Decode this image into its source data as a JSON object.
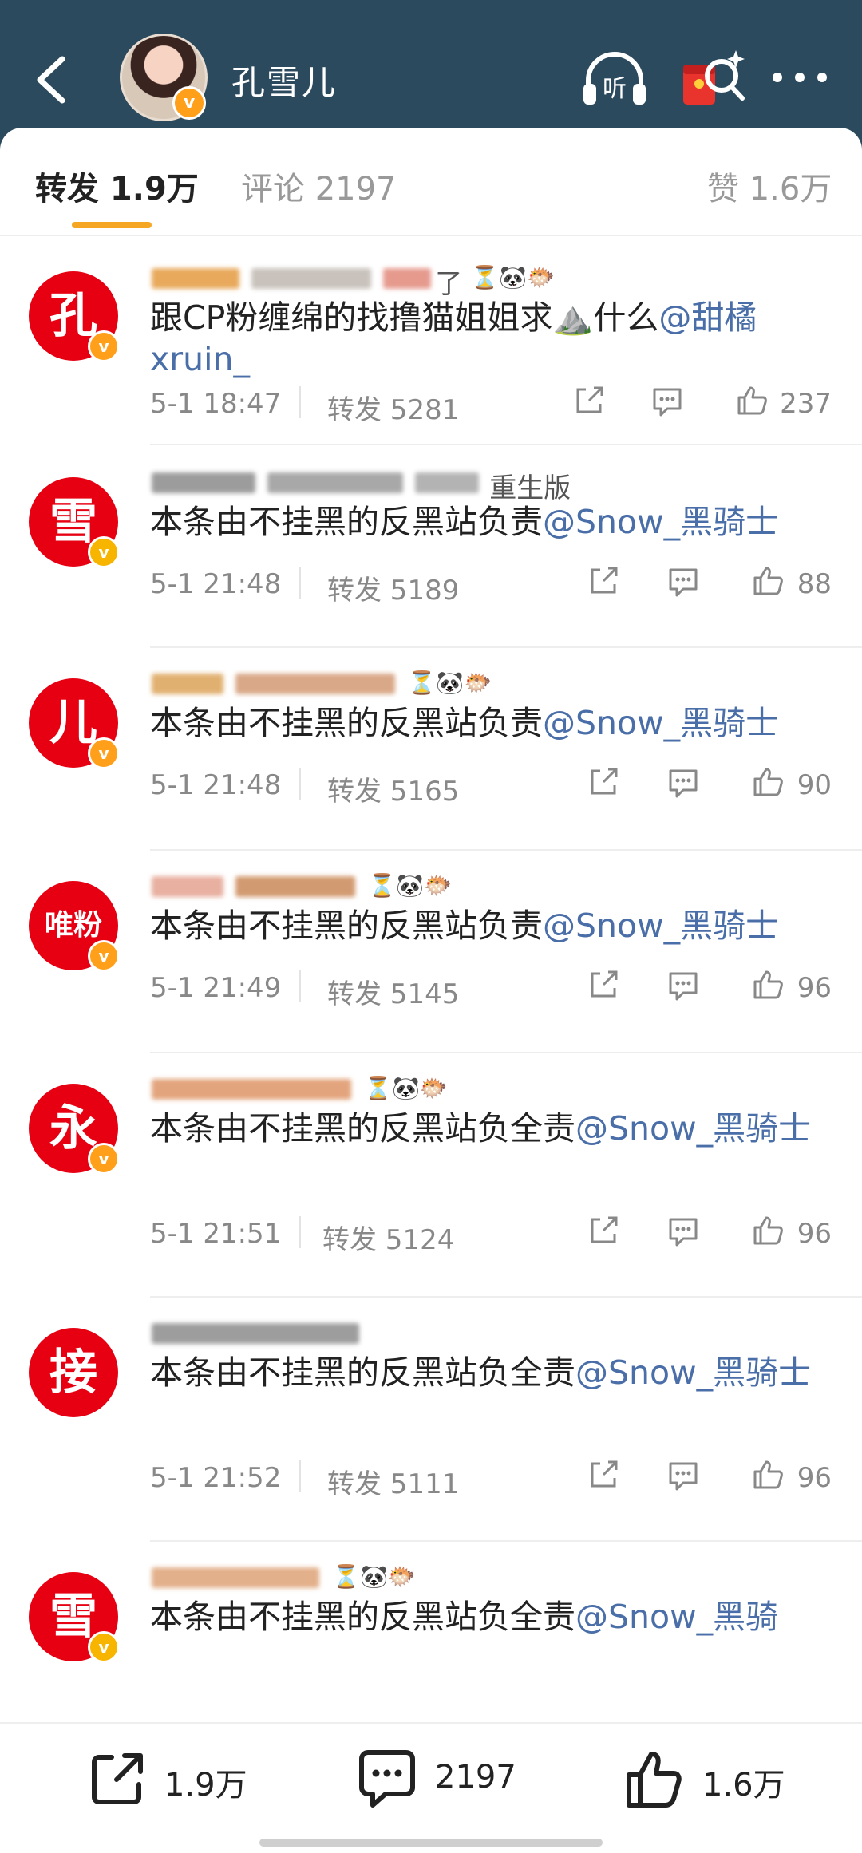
{
  "header": {
    "title": "孔雪儿",
    "verified_mark": "v",
    "listen_label": "听",
    "bg_color": "#2b4a5e"
  },
  "tabs": {
    "repost_label": "转发 1.9万",
    "comment_label": "评论 2197",
    "like_label": "赞 1.6万",
    "accent_color": "#f5a623"
  },
  "reposts": [
    {
      "avatar_text": "孔",
      "nickname_visible": "了",
      "nickname_emojis": "⏳🐼🐡",
      "text": "跟CP粉缠绵的找撸猫姐姐求⛰️什么",
      "mention": "@甜橘xruin_",
      "time": "5-1 18:47",
      "reposts": "转发 5281",
      "likes": "237"
    },
    {
      "avatar_text": "雪",
      "nickname_visible": "重生版",
      "nickname_emojis": "",
      "text": "本条由不挂黑的反黑站负责",
      "mention": "@Snow_黑骑士",
      "time": "5-1 21:48",
      "reposts": "转发 5189",
      "likes": "88"
    },
    {
      "avatar_text": "儿",
      "nickname_visible": "",
      "nickname_emojis": "⏳🐼🐡",
      "text": "本条由不挂黑的反黑站负责",
      "mention": "@Snow_黑骑士",
      "time": "5-1 21:48",
      "reposts": "转发 5165",
      "likes": "90"
    },
    {
      "avatar_text": "唯粉",
      "nickname_visible": "",
      "nickname_emojis": "⏳🐼🐡",
      "text": "本条由不挂黑的反黑站负责",
      "mention": "@Snow_黑骑士",
      "time": "5-1 21:49",
      "reposts": "转发 5145",
      "likes": "96"
    },
    {
      "avatar_text": "永",
      "nickname_visible": "",
      "nickname_emojis": "⏳🐼🐡",
      "text": "本条由不挂黑的反黑站负全责",
      "mention": "@Snow_黑骑士",
      "time": "5-1 21:51",
      "reposts": "转发 5124",
      "likes": "96"
    },
    {
      "avatar_text": "接",
      "nickname_visible": "",
      "nickname_emojis": "",
      "text": "本条由不挂黑的反黑站负全责",
      "mention": "@Snow_黑骑士",
      "time": "5-1 21:52",
      "reposts": "转发 5111",
      "likes": "96"
    },
    {
      "avatar_text": "雪",
      "nickname_visible": "",
      "nickname_emojis": "⏳🐼🐡",
      "text": "本条由不挂黑的反黑站负全责",
      "mention": "@Snow_黑骑",
      "time": "",
      "reposts": "",
      "likes": ""
    }
  ],
  "bottom_bar": {
    "repost_count": "1.9万",
    "comment_count": "2197",
    "like_count": "1.6万"
  }
}
